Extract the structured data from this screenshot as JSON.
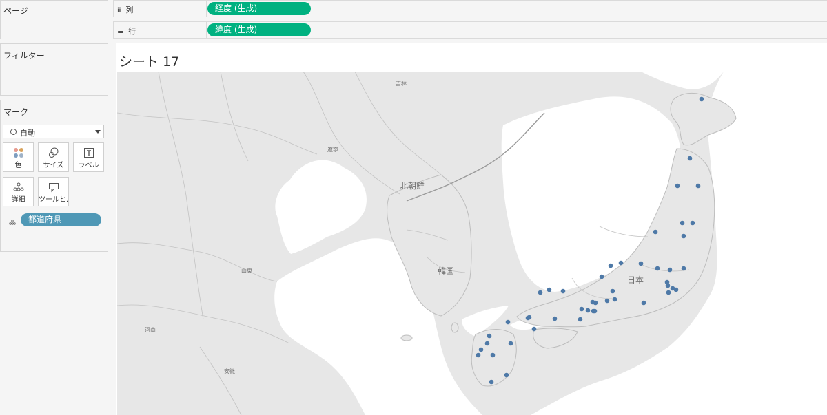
{
  "left_pane": {
    "pages_title": "ページ",
    "filters_title": "フィルター",
    "marks": {
      "title": "マーク",
      "mark_type": "自動",
      "buttons": [
        {
          "icon": "color-icon",
          "label": "色"
        },
        {
          "icon": "size-icon",
          "label": "サイズ"
        },
        {
          "icon": "label-icon",
          "label": "ラベル"
        },
        {
          "icon": "detail-icon",
          "label": "詳細"
        },
        {
          "icon": "tooltip-icon",
          "label": "ツールヒ..."
        }
      ],
      "detail_field": "都道府県"
    }
  },
  "shelves": {
    "columns": {
      "label": "列",
      "pill": "経度 (生成)"
    },
    "rows": {
      "label": "行",
      "pill": "緯度 (生成)"
    }
  },
  "colors": {
    "pill_green": "#00b180",
    "pill_blue": "#4f98b6",
    "mark": "#4e79a7",
    "water": "#ffffff",
    "land": "#e7e7e7"
  },
  "sheet": {
    "title": "シート 17",
    "map_labels": {
      "jilin": "吉林",
      "liaoning": "遼寧",
      "north_korea": "北朝鮮",
      "south_korea": "韓国",
      "japan": "日本",
      "shandong": "山東",
      "henan": "河南",
      "anhui": "安徽"
    },
    "prefecture_mark_count": 47
  }
}
